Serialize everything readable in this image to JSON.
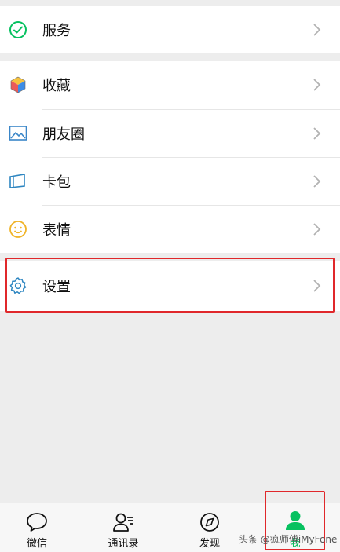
{
  "menu": {
    "services": {
      "label": "服务",
      "icon": "wechat-pay-icon"
    },
    "favorites": {
      "label": "收藏",
      "icon": "cube-icon"
    },
    "moments": {
      "label": "朋友圈",
      "icon": "picture-icon"
    },
    "cards": {
      "label": "卡包",
      "icon": "card-icon"
    },
    "stickers": {
      "label": "表情",
      "icon": "smiley-icon"
    },
    "settings": {
      "label": "设置",
      "icon": "gear-icon"
    }
  },
  "tabbar": {
    "chats": "微信",
    "contacts": "通讯录",
    "discover": "发现",
    "me": "我"
  },
  "watermark": "头条 @疯师傅iMyFone",
  "colors": {
    "accent": "#07C160",
    "highlight": "#E0282B",
    "background": "#EDEDED"
  }
}
